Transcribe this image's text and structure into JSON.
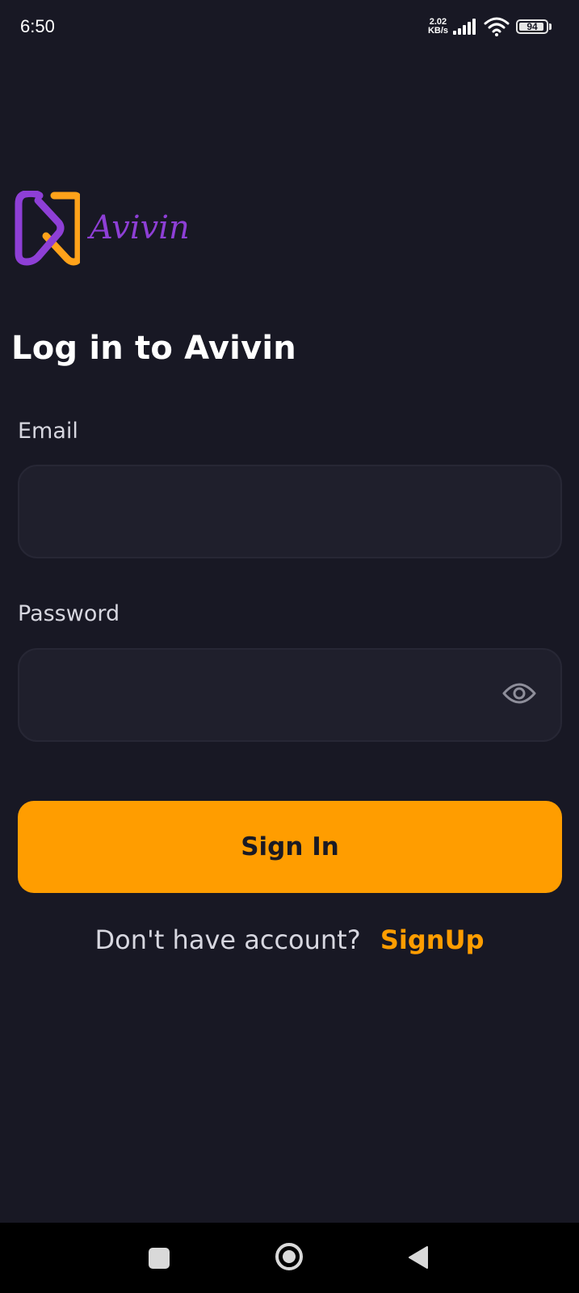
{
  "status_bar": {
    "time": "6:50",
    "net_speed_value": "2.02",
    "net_speed_unit": "KB/s",
    "battery_level": "94",
    "battery_fraction": 0.94
  },
  "logo": {
    "wordmark": "Avivin",
    "colors": {
      "purple": "#8e3fd6",
      "orange": "#ffa21a"
    }
  },
  "login": {
    "title": "Log in to Avivin",
    "email_label": "Email",
    "email_value": "",
    "password_label": "Password",
    "password_value": "",
    "sign_in_label": "Sign In",
    "signup_prompt": "Don't have account?",
    "signup_link": "SignUp"
  },
  "theme": {
    "background": "#181824",
    "input_background": "#1f1f2c",
    "accent": "#ff9d00"
  },
  "icons": {
    "password_toggle": "eye-icon",
    "nav_recents": "square-icon",
    "nav_home": "circle-icon",
    "nav_back": "triangle-back-icon"
  }
}
